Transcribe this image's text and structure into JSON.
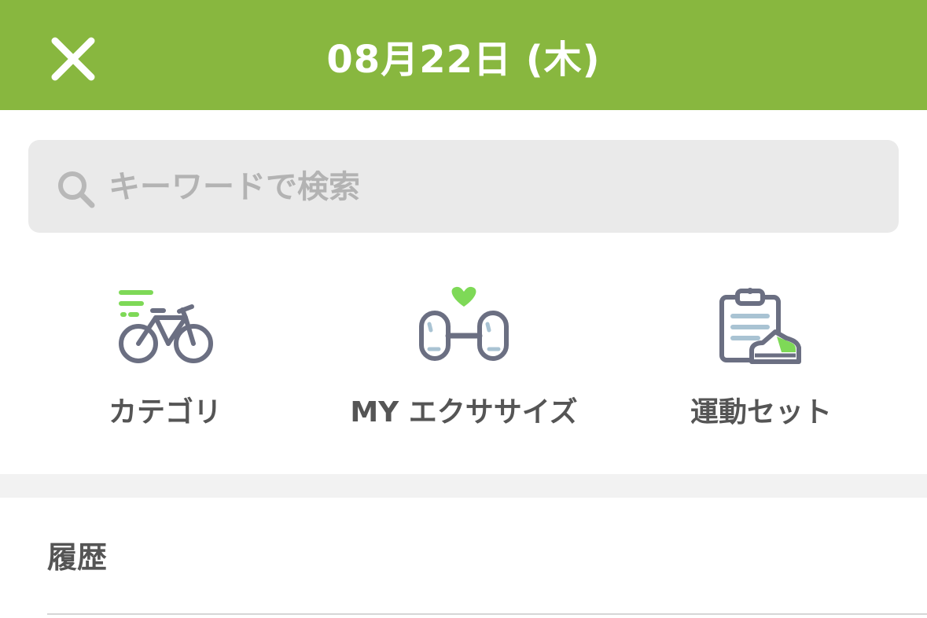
{
  "header": {
    "title": "08月22日 (木)",
    "close_icon": "close-icon",
    "background_color": "#88b73f"
  },
  "search": {
    "placeholder": "キーワードで検索",
    "value": "",
    "icon": "search-icon"
  },
  "shortcuts": [
    {
      "label": "カテゴリ",
      "icon": "bicycle-icon"
    },
    {
      "label": "MY エクササイズ",
      "icon": "dumbbell-heart-icon"
    },
    {
      "label": "運動セット",
      "icon": "clipboard-shoe-icon"
    }
  ],
  "history": {
    "heading": "履歴"
  },
  "colors": {
    "accent": "#88b73f",
    "icon_green": "#7ed957",
    "icon_gray": "#6b6f82",
    "icon_blue": "#a9c3d3"
  }
}
